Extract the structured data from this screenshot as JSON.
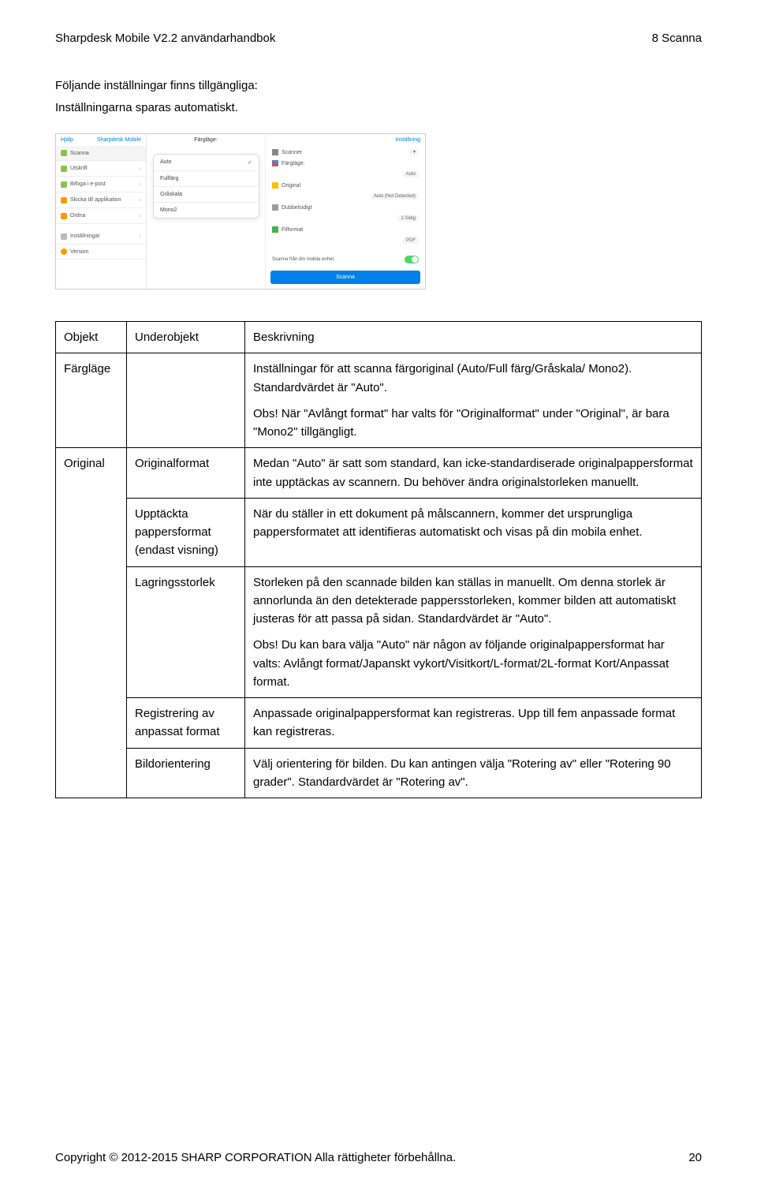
{
  "header": {
    "left": "Sharpdesk Mobile V2.2 användarhandbok",
    "right": "8 Scanna"
  },
  "intro": {
    "line1": "Följande inställningar finns tillgängliga:",
    "line2": "Inställningarna sparas automatiskt."
  },
  "screenshot": {
    "sidebar_top_left": "Hjälp",
    "sidebar_top_right": "Sharpdesk Mobile",
    "middle_top": "Färgläge:",
    "right_top": "Inställning",
    "side_items": [
      "Scanna",
      "Utskrift",
      "Bifoga i e-post",
      "Skicka till applikation",
      "Ordna",
      "Inställningar",
      "Version"
    ],
    "popup_items": [
      "Auto",
      "Fullfärg",
      "Gråskala",
      "Mono2"
    ],
    "popup_selected": 0,
    "right_scanner": "Scanner",
    "right_scanner_val": "",
    "right_farglage": "Färgläge:",
    "right_farglage_val": "Auto",
    "right_original": "Original",
    "right_original_val": "Auto (Not Detected)",
    "right_dubbel": "Dubbelsidigt",
    "right_dubbel_val": "1-Sidig",
    "right_filformat": "Filformat",
    "right_filformat_val": "PDF",
    "right_scan_from": "Scanna från din mobila enhet.",
    "right_scan_btn": "Scanna"
  },
  "table": {
    "headers": {
      "obj": "Objekt",
      "sub": "Underobjekt",
      "desc": "Beskrivning"
    },
    "farglage": {
      "obj": "Färgläge",
      "desc_p1": "Inställningar för att scanna färgoriginal (Auto/Full färg/Gråskala/ Mono2). Standardvärdet är \"Auto\".",
      "desc_p2": "Obs! När \"Avlångt format\" har valts för \"Originalformat\" under \"Original\", är bara \"Mono2\" tillgängligt."
    },
    "original": {
      "obj": "Original",
      "rows": {
        "originalformat": {
          "sub": "Originalformat",
          "desc": "Medan \"Auto\" är satt som standard, kan icke-standardiserade originalpappersformat inte upptäckas av scannern. Du behöver ändra originalstorleken manuellt."
        },
        "upptackta": {
          "sub": "Upptäckta pappersformat (endast visning)",
          "desc": "När du ställer in ett dokument på målscannern, kommer det ursprungliga pappersformatet att identifieras automatiskt och visas på din mobila enhet."
        },
        "lagring": {
          "sub": "Lagringsstorlek",
          "desc_p1": "Storleken på den scannade bilden kan ställas in manuellt. Om denna storlek är annorlunda än den detekterade pappersstorleken, kommer bilden att automatiskt justeras för att passa på sidan. Standardvärdet är \"Auto\".",
          "desc_p2": "Obs! Du kan bara välja \"Auto\" när någon av följande originalpappersformat har valts: Avlångt format/Japanskt vykort/Visitkort/L-format/2L-format Kort/Anpassat format."
        },
        "registrering": {
          "sub": "Registrering av anpassat format",
          "desc": "Anpassade originalpappersformat kan registreras. Upp till fem anpassade format kan registreras."
        },
        "bildorientering": {
          "sub": "Bildorientering",
          "desc": "Välj orientering för bilden. Du kan antingen välja \"Rotering av\" eller \"Rotering 90 grader\". Standardvärdet är \"Rotering av\"."
        }
      }
    }
  },
  "footer": {
    "left": "Copyright © 2012-2015 SHARP CORPORATION Alla rättigheter förbehållna.",
    "right": "20"
  }
}
